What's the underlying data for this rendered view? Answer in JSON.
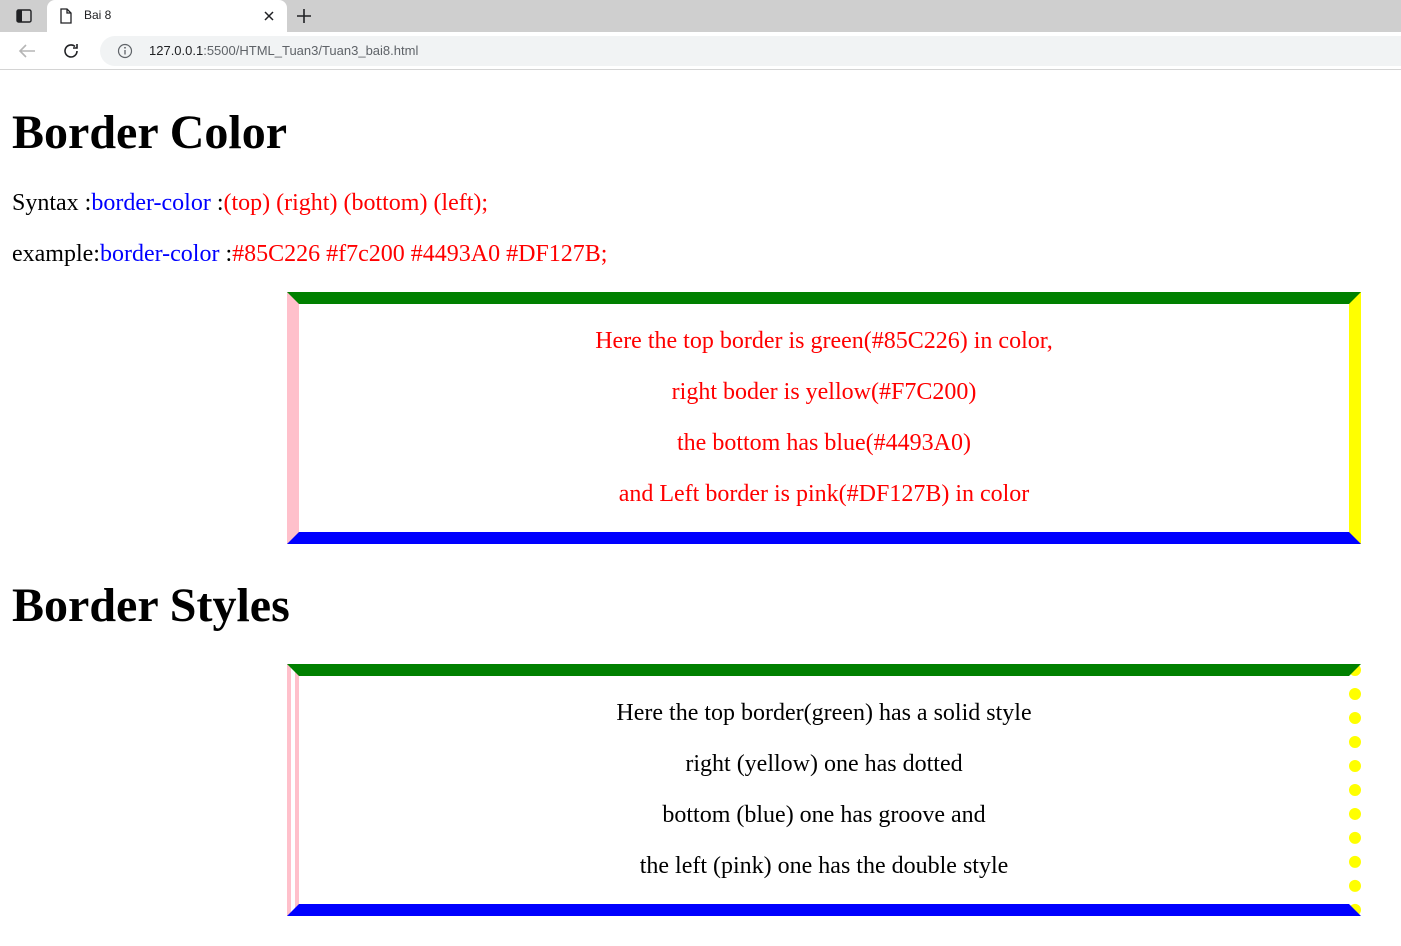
{
  "browser": {
    "tab": {
      "title": "Bai 8"
    },
    "address_bar": {
      "host": "127.0.0.1",
      "path": ":5500/HTML_Tuan3/Tuan3_bai8.html"
    }
  },
  "page": {
    "section1": {
      "heading": "Border Color",
      "syntax": {
        "label": "Syntax :",
        "property": "border-color",
        "sep": " :",
        "value": "(top) (right) (bottom) (left);"
      },
      "example": {
        "label": "example:",
        "property": "border-color",
        "sep": " :",
        "value": "#85C226 #f7c200 #4493A0 #DF127B;"
      },
      "box_lines": [
        "Here the top border is green(#85C226) in color,",
        "right boder is yellow(#F7C200)",
        "the bottom has blue(#4493A0)",
        "and Left border is pink(#DF127B) in color"
      ],
      "border_colors": {
        "top": "#008000",
        "right": "#ffff00",
        "bottom": "#0000ff",
        "left": "#ffc0cb"
      }
    },
    "section2": {
      "heading": "Border Styles",
      "box_lines": [
        "Here the top border(green) has a solid style",
        "right (yellow) one has dotted",
        "bottom (blue) one has groove and",
        "the left (pink) one has the double style"
      ]
    },
    "colors": {
      "keyword": "#0000ff",
      "value": "#ff0000"
    }
  },
  "icons": [
    "tab-actions-icon",
    "page-icon",
    "close-icon",
    "new-tab-icon",
    "back-arrow-icon",
    "reload-icon",
    "info-icon"
  ]
}
